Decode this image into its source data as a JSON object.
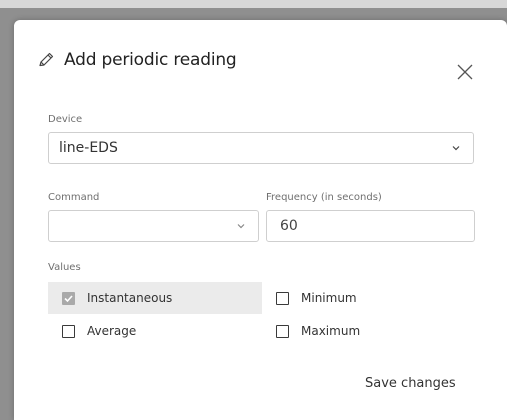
{
  "dialog": {
    "title": "Add periodic reading",
    "icon": "pencil-icon",
    "close_icon": "close-icon"
  },
  "device": {
    "label": "Device",
    "value": "line-EDS"
  },
  "command": {
    "label": "Command",
    "value": ""
  },
  "frequency": {
    "label": "Frequency (in seconds)",
    "value": "60"
  },
  "values": {
    "label": "Values",
    "options": [
      {
        "label": "Instantaneous",
        "checked": true
      },
      {
        "label": "Minimum",
        "checked": false
      },
      {
        "label": "Average",
        "checked": false
      },
      {
        "label": "Maximum",
        "checked": false
      }
    ]
  },
  "actions": {
    "save_label": "Save changes"
  }
}
